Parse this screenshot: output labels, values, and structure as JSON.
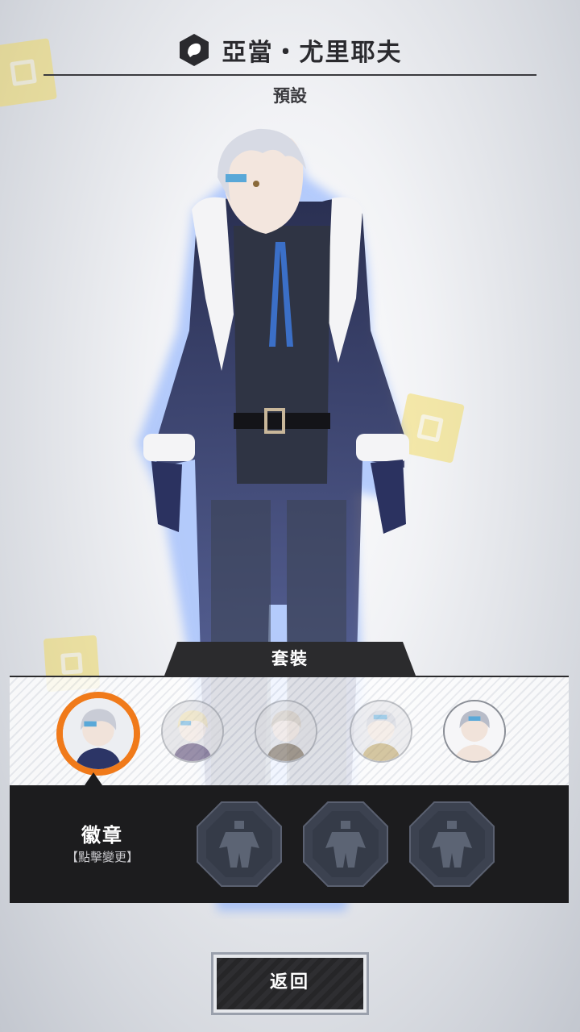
{
  "header": {
    "title": "亞當・尤里耶夫",
    "subtitle": "預設",
    "icon": "emblem-hexagon-icon"
  },
  "outfit": {
    "tab_label": "套裝",
    "avatars": [
      {
        "name": "outfit-avatar-1",
        "state": "selected"
      },
      {
        "name": "outfit-avatar-2",
        "state": "dimmed"
      },
      {
        "name": "outfit-avatar-3",
        "state": "dimmed"
      },
      {
        "name": "outfit-avatar-4",
        "state": "dimmed"
      },
      {
        "name": "outfit-avatar-5",
        "state": "normal"
      }
    ]
  },
  "badge": {
    "label": "徽章",
    "hint": "【點擊變更】",
    "slots": [
      "badge-slot-empty",
      "badge-slot-empty",
      "badge-slot-empty"
    ]
  },
  "footer": {
    "back_label": "返回"
  },
  "colors": {
    "accent": "#f07a1a",
    "panel_dark": "#1c1c1e",
    "title_text": "#2a2a2e"
  }
}
